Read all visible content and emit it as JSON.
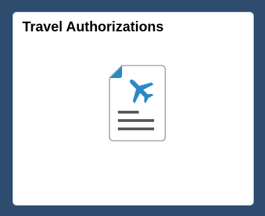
{
  "tile": {
    "title": "Travel Authorizations",
    "icon": "travel-document-airplane-icon"
  },
  "colors": {
    "page_background": "#2e4c6d",
    "tile_background": "#ffffff",
    "icon_accent": "#2a89c8",
    "icon_lines": "#595959"
  }
}
